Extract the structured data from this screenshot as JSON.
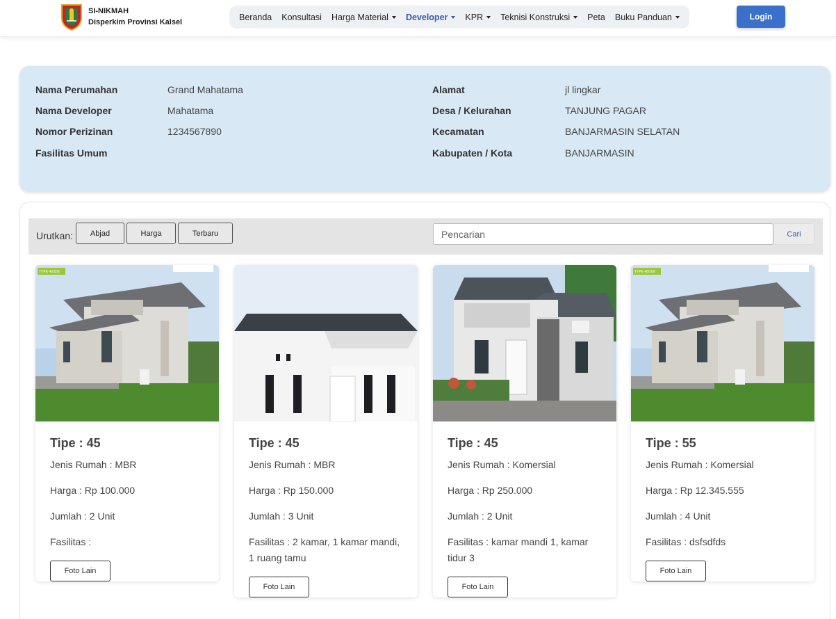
{
  "brand": {
    "title": "SI-NIKMAH",
    "subtitle": "Disperkim Provinsi Kalsel"
  },
  "nav": {
    "items": [
      {
        "label": "Beranda",
        "dropdown": false,
        "active": false
      },
      {
        "label": "Konsultasi",
        "dropdown": false,
        "active": false
      },
      {
        "label": "Harga Material",
        "dropdown": true,
        "active": false
      },
      {
        "label": "Developer",
        "dropdown": true,
        "active": true
      },
      {
        "label": "KPR",
        "dropdown": true,
        "active": false
      },
      {
        "label": "Teknisi Konstruksi",
        "dropdown": true,
        "active": false
      },
      {
        "label": "Peta",
        "dropdown": false,
        "active": false
      },
      {
        "label": "Buku Panduan",
        "dropdown": true,
        "active": false
      }
    ],
    "login_label": "Login"
  },
  "info": {
    "left": [
      {
        "label": "Nama Perumahan",
        "value": "Grand Mahatama"
      },
      {
        "label": "Nama Developer",
        "value": "Mahatama"
      },
      {
        "label": "Nomor Perizinan",
        "value": "1234567890"
      },
      {
        "label": "Fasilitas Umum",
        "value": ""
      }
    ],
    "right": [
      {
        "label": "Alamat",
        "value": "jl lingkar"
      },
      {
        "label": "Desa / Kelurahan",
        "value": "TANJUNG PAGAR"
      },
      {
        "label": "Kecamatan",
        "value": "BANJARMASIN SELATAN"
      },
      {
        "label": "Kabupaten / Kota",
        "value": "BANJARMASIN"
      }
    ]
  },
  "toolbar": {
    "sort_label": "Urutkan:",
    "sort_buttons": [
      "Abjad",
      "Harga",
      "Terbaru"
    ],
    "search_placeholder": "Pencarian",
    "search_button": "Cari"
  },
  "cards": [
    {
      "title": "Tipe : 45",
      "jenis": "Jenis Rumah : MBR",
      "harga": "Harga : Rp 100.000",
      "jumlah": "Jumlah : 2 Unit",
      "fasilitas": "Fasilitas :",
      "photo_button": "Foto Lain",
      "image": "house-photo-gray-two-story",
      "badge": "TYPE 45/106"
    },
    {
      "title": "Tipe : 45",
      "jenis": "Jenis Rumah : MBR",
      "harga": "Harga : Rp 150.000",
      "jumlah": "Jumlah : 3 Unit",
      "fasilitas": "Fasilitas : 2 kamar, 1 kamar mandi, 1 ruang tamu",
      "photo_button": "Foto Lain",
      "image": "house-photo-white",
      "badge": ""
    },
    {
      "title": "Tipe : 45",
      "jenis": "Jenis Rumah : Komersial",
      "harga": "Harga : Rp 250.000",
      "jumlah": "Jumlah : 2 Unit",
      "fasilitas": "Fasilitas : kamar mandi 1, kamar tidur 3",
      "photo_button": "Foto Lain",
      "image": "house-photo-modern-gray",
      "badge": ""
    },
    {
      "title": "Tipe : 55",
      "jenis": "Jenis Rumah : Komersial",
      "harga": "Harga : Rp 12.345.555",
      "jumlah": "Jumlah : 4 Unit",
      "fasilitas": "Fasilitas : dsfsdfds",
      "photo_button": "Foto Lain",
      "image": "house-photo-gray-two-story",
      "badge": "TYPE 45/106"
    }
  ],
  "colors": {
    "primary": "#3a70c9",
    "active_nav": "#3a5aa8",
    "info_panel_bg": "#d9e8f5",
    "toolbar_bg": "#e4e4e4"
  }
}
